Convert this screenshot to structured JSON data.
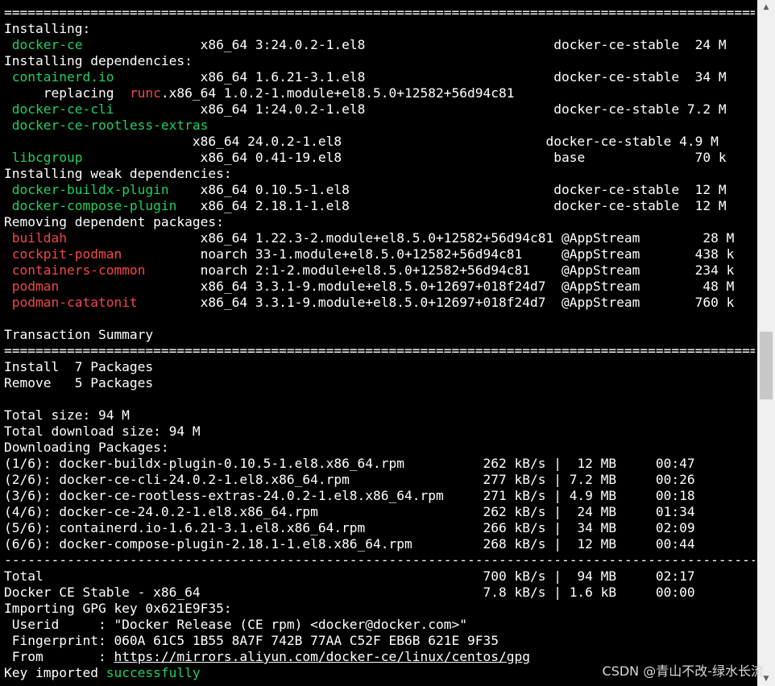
{
  "terminal": {
    "lines": [
      [
        {
          "t": "================================================================================================",
          "c": "w"
        }
      ],
      [
        {
          "t": "Installing:",
          "c": "w"
        }
      ],
      [
        {
          "t": " ",
          "c": "w"
        },
        {
          "t": "docker-ce",
          "c": "g"
        },
        {
          "t": "               x86_64 3:24.0.2-1.el8                        docker-ce-stable  24 M",
          "c": "w"
        }
      ],
      [
        {
          "t": "Installing dependencies:",
          "c": "w"
        }
      ],
      [
        {
          "t": " ",
          "c": "w"
        },
        {
          "t": "containerd.io",
          "c": "g"
        },
        {
          "t": "           x86_64 1.6.21-3.1.el8                        docker-ce-stable  34 M",
          "c": "w"
        }
      ],
      [
        {
          "t": "     replacing  ",
          "c": "w"
        },
        {
          "t": "runc",
          "c": "r"
        },
        {
          "t": ".x86_64 1.0.2-1.module+el8.5.0+12582+56d94c81",
          "c": "w"
        }
      ],
      [
        {
          "t": " ",
          "c": "w"
        },
        {
          "t": "docker-ce-cli",
          "c": "g"
        },
        {
          "t": "           x86_64 1:24.0.2-1.el8                        docker-ce-stable 7.2 M",
          "c": "w"
        }
      ],
      [
        {
          "t": " ",
          "c": "w"
        },
        {
          "t": "docker-ce-rootless-extras",
          "c": "g"
        }
      ],
      [
        {
          "t": "                        x86_64 24.0.2-1.el8                          docker-ce-stable 4.9 M",
          "c": "w"
        }
      ],
      [
        {
          "t": " ",
          "c": "w"
        },
        {
          "t": "libcgroup",
          "c": "g"
        },
        {
          "t": "               x86_64 0.41-19.el8                           base              70 k",
          "c": "w"
        }
      ],
      [
        {
          "t": "Installing weak dependencies:",
          "c": "w"
        }
      ],
      [
        {
          "t": " ",
          "c": "w"
        },
        {
          "t": "docker-buildx-plugin",
          "c": "g"
        },
        {
          "t": "    x86_64 0.10.5-1.el8                          docker-ce-stable  12 M",
          "c": "w"
        }
      ],
      [
        {
          "t": " ",
          "c": "w"
        },
        {
          "t": "docker-compose-plugin",
          "c": "g"
        },
        {
          "t": "   x86_64 2.18.1-1.el8                          docker-ce-stable  12 M",
          "c": "w"
        }
      ],
      [
        {
          "t": "Removing dependent packages:",
          "c": "w"
        }
      ],
      [
        {
          "t": " ",
          "c": "w"
        },
        {
          "t": "buildah",
          "c": "r"
        },
        {
          "t": "                 x86_64 1.22.3-2.module+el8.5.0+12582+56d94c81 @AppStream        28 M",
          "c": "w"
        }
      ],
      [
        {
          "t": " ",
          "c": "w"
        },
        {
          "t": "cockpit-podman",
          "c": "r"
        },
        {
          "t": "          noarch 33-1.module+el8.5.0+12582+56d94c81     @AppStream       438 k",
          "c": "w"
        }
      ],
      [
        {
          "t": " ",
          "c": "w"
        },
        {
          "t": "containers-common",
          "c": "r"
        },
        {
          "t": "       noarch 2:1-2.module+el8.5.0+12582+56d94c81    @AppStream       234 k",
          "c": "w"
        }
      ],
      [
        {
          "t": " ",
          "c": "w"
        },
        {
          "t": "podman",
          "c": "r"
        },
        {
          "t": "                  x86_64 3.3.1-9.module+el8.5.0+12697+018f24d7  @AppStream        48 M",
          "c": "w"
        }
      ],
      [
        {
          "t": " ",
          "c": "w"
        },
        {
          "t": "podman-catatonit",
          "c": "r"
        },
        {
          "t": "        x86_64 3.3.1-9.module+el8.5.0+12697+018f24d7  @AppStream       760 k",
          "c": "w"
        }
      ],
      [
        {
          "t": "",
          "c": "w"
        }
      ],
      [
        {
          "t": "Transaction Summary",
          "c": "w"
        }
      ],
      [
        {
          "t": "================================================================================================",
          "c": "w"
        }
      ],
      [
        {
          "t": "Install  7 Packages",
          "c": "w"
        }
      ],
      [
        {
          "t": "Remove   5 Packages",
          "c": "w"
        }
      ],
      [
        {
          "t": "",
          "c": "w"
        }
      ],
      [
        {
          "t": "Total size: 94 M",
          "c": "w"
        }
      ],
      [
        {
          "t": "Total download size: 94 M",
          "c": "w"
        }
      ],
      [
        {
          "t": "Downloading Packages:",
          "c": "w"
        }
      ],
      [
        {
          "t": "(1/6): docker-buildx-plugin-0.10.5-1.el8.x86_64.rpm          262 kB/s |  12 MB     00:47",
          "c": "w"
        }
      ],
      [
        {
          "t": "(2/6): docker-ce-cli-24.0.2-1.el8.x86_64.rpm                 277 kB/s | 7.2 MB     00:26",
          "c": "w"
        }
      ],
      [
        {
          "t": "(3/6): docker-ce-rootless-extras-24.0.2-1.el8.x86_64.rpm     271 kB/s | 4.9 MB     00:18",
          "c": "w"
        }
      ],
      [
        {
          "t": "(4/6): docker-ce-24.0.2-1.el8.x86_64.rpm                     262 kB/s |  24 MB     01:34",
          "c": "w"
        }
      ],
      [
        {
          "t": "(5/6): containerd.io-1.6.21-3.1.el8.x86_64.rpm               266 kB/s |  34 MB     02:09",
          "c": "w"
        }
      ],
      [
        {
          "t": "(6/6): docker-compose-plugin-2.18.1-1.el8.x86_64.rpm         268 kB/s |  12 MB     00:44",
          "c": "w"
        }
      ],
      [
        {
          "t": "------------------------------------------------------------------------------------------------",
          "c": "w"
        }
      ],
      [
        {
          "t": "Total                                                        700 kB/s |  94 MB     02:17",
          "c": "w"
        }
      ],
      [
        {
          "t": "Docker CE Stable - x86_64                                    7.8 kB/s | 1.6 kB     00:00",
          "c": "w"
        }
      ],
      [
        {
          "t": "Importing GPG key 0x621E9F35:",
          "c": "w"
        }
      ],
      [
        {
          "t": " Userid     : \"Docker Release (CE rpm) <docker@docker.com>\"",
          "c": "w"
        }
      ],
      [
        {
          "t": " Fingerprint: 060A 61C5 1B55 8A7F 742B 77AA C52F EB6B 621E 9F35",
          "c": "w"
        }
      ],
      [
        {
          "t": " From       : ",
          "c": "w"
        },
        {
          "t": "https://mirrors.aliyun.com/docker-ce/linux/centos/gpg",
          "c": "u"
        }
      ],
      [
        {
          "t": "Key imported ",
          "c": "w"
        },
        {
          "t": "successfully",
          "c": "g"
        }
      ]
    ]
  },
  "scrollbar": {
    "up_arrow": "▲",
    "down_arrow": "▼"
  },
  "watermark": "CSDN @青山不改-绿水长流",
  "colors": {
    "background": "#000000",
    "text": "#ffffff",
    "green": "#20d060",
    "red": "#f44747"
  }
}
